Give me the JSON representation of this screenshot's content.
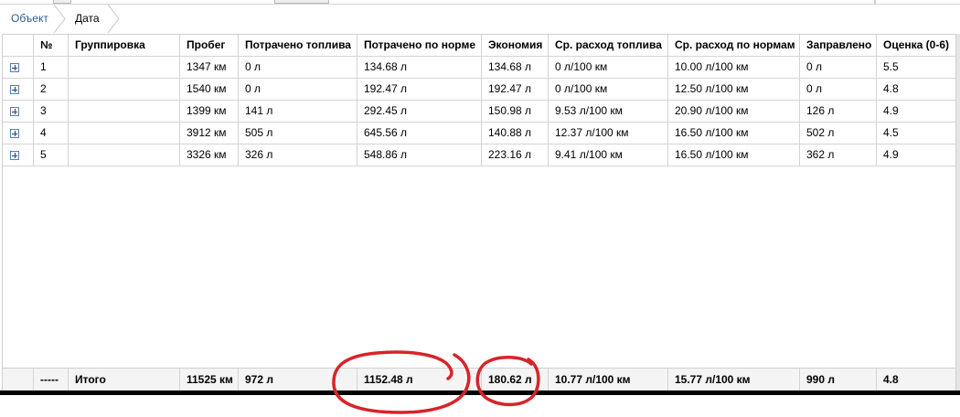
{
  "breadcrumb": {
    "items": [
      "Объект",
      "Дата"
    ]
  },
  "columns": [
    "",
    "№",
    "Группировка",
    "Пробег",
    "Потрачено топлива",
    "Потрачено по норме",
    "Экономия",
    "Ср. расход топлива",
    "Ср. расход по нормам",
    "Заправлено",
    "Оценка (0-6)"
  ],
  "rows": [
    {
      "num": "1",
      "group": "",
      "mileage": "1347 км",
      "fuel_spent": "0 л",
      "fuel_norm": "134.68 л",
      "economy": "134.68 л",
      "avg_fuel": "0 л/100 км",
      "avg_norm": "10.00 л/100 км",
      "refueled": "0 л",
      "score": "5.5"
    },
    {
      "num": "2",
      "group": "",
      "mileage": "1540 км",
      "fuel_spent": "0 л",
      "fuel_norm": "192.47 л",
      "economy": "192.47 л",
      "avg_fuel": "0 л/100 км",
      "avg_norm": "12.50 л/100 км",
      "refueled": "0 л",
      "score": "4.8"
    },
    {
      "num": "3",
      "group": "",
      "mileage": "1399 км",
      "fuel_spent": "141 л",
      "fuel_norm": "292.45 л",
      "economy": "150.98 л",
      "avg_fuel": "9.53 л/100 км",
      "avg_norm": "20.90 л/100 км",
      "refueled": "126 л",
      "score": "4.9"
    },
    {
      "num": "4",
      "group": "",
      "mileage": "3912 км",
      "fuel_spent": "505 л",
      "fuel_norm": "645.56 л",
      "economy": "140.88 л",
      "avg_fuel": "12.37 л/100 км",
      "avg_norm": "16.50 л/100 км",
      "refueled": "502 л",
      "score": "4.5"
    },
    {
      "num": "5",
      "group": "",
      "mileage": "3326 км",
      "fuel_spent": "326 л",
      "fuel_norm": "548.86 л",
      "economy": "223.16 л",
      "avg_fuel": "9.41 л/100 км",
      "avg_norm": "16.50 л/100 км",
      "refueled": "362 л",
      "score": "4.9"
    }
  ],
  "totals": {
    "num": "-----",
    "group": "Итого",
    "mileage": "11525 км",
    "fuel_spent": "972 л",
    "fuel_norm": "1152.48 л",
    "economy": "180.62 л",
    "avg_fuel": "10.77 л/100 км",
    "avg_norm": "15.77 л/100 км",
    "refueled": "990 л",
    "score": "4.8"
  },
  "annotation_color": "#d8232a"
}
